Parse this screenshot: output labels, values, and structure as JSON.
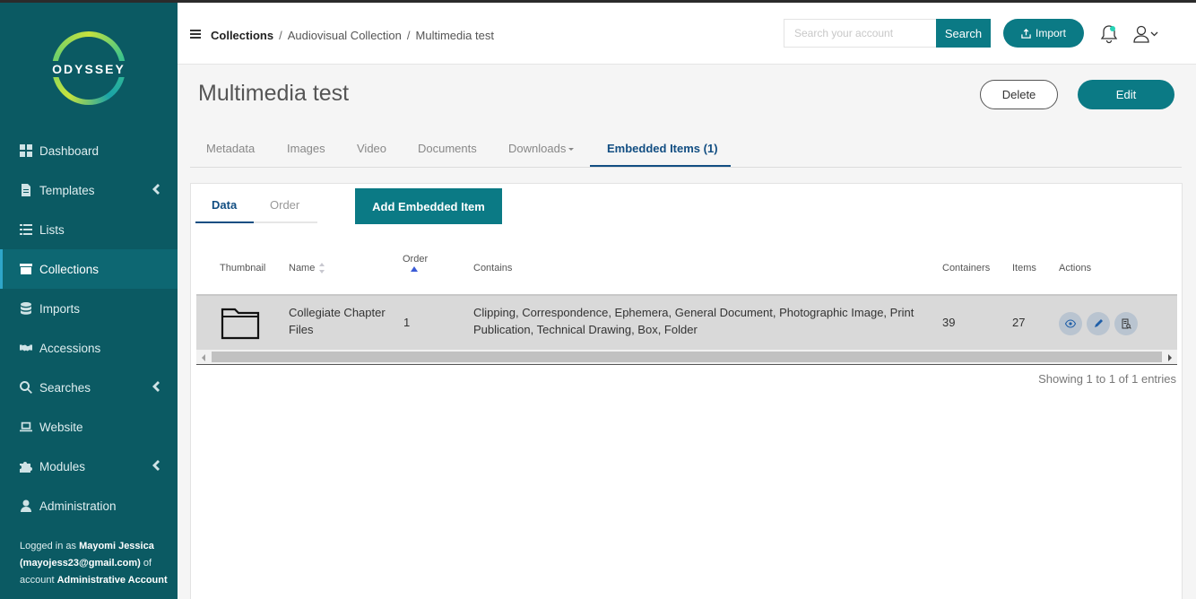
{
  "app": {
    "logo_text": "ODYSSEY"
  },
  "sidebar": {
    "items": [
      {
        "label": "Dashboard",
        "icon": "dashboard-icon"
      },
      {
        "label": "Templates",
        "icon": "document-icon",
        "has_submenu": true
      },
      {
        "label": "Lists",
        "icon": "list-icon"
      },
      {
        "label": "Collections",
        "icon": "archive-icon",
        "active": true
      },
      {
        "label": "Imports",
        "icon": "database-icon"
      },
      {
        "label": "Accessions",
        "icon": "handshake-icon"
      },
      {
        "label": "Searches",
        "icon": "search-doc-icon",
        "has_submenu": true
      },
      {
        "label": "Website",
        "icon": "laptop-icon"
      },
      {
        "label": "Modules",
        "icon": "puzzle-icon",
        "has_submenu": true
      },
      {
        "label": "Administration",
        "icon": "user-icon"
      }
    ],
    "login": {
      "prefix": "Logged in as ",
      "user": "Mayomi Jessica",
      "email": "(mayojess23@gmail.com)",
      "mid": " of account ",
      "account": "Administrative Account"
    }
  },
  "header": {
    "breadcrumb": [
      "Collections",
      "Audiovisual Collection",
      "Multimedia test"
    ],
    "search_placeholder": "Search your account",
    "search_label": "Search",
    "import_label": "Import"
  },
  "page": {
    "title": "Multimedia test",
    "delete_label": "Delete",
    "edit_label": "Edit"
  },
  "tabs": [
    "Metadata",
    "Images",
    "Video",
    "Documents",
    "Downloads",
    "Embedded Items (1)"
  ],
  "panel": {
    "subtabs": [
      "Data",
      "Order"
    ],
    "add_label": "Add Embedded Item",
    "columns": [
      "Thumbnail",
      "Name",
      "Order",
      "Contains",
      "Containers",
      "Items",
      "Actions"
    ],
    "rows": [
      {
        "name_line1": "Collegiate Chapter",
        "name_line2": "Files",
        "order": "1",
        "contains_line1": "Clipping, Correspondence, Ephemera, General Document, Photographic Image, Print",
        "contains_line2": "Publication, Technical Drawing, Box, Folder",
        "containers": "39",
        "items": "27"
      }
    ],
    "showing": "Showing 1 to 1 of 1 entries"
  },
  "colors": {
    "sidebar_bg": "#0b5a63",
    "primary": "#0b7a85",
    "tab_active": "#124e82"
  }
}
